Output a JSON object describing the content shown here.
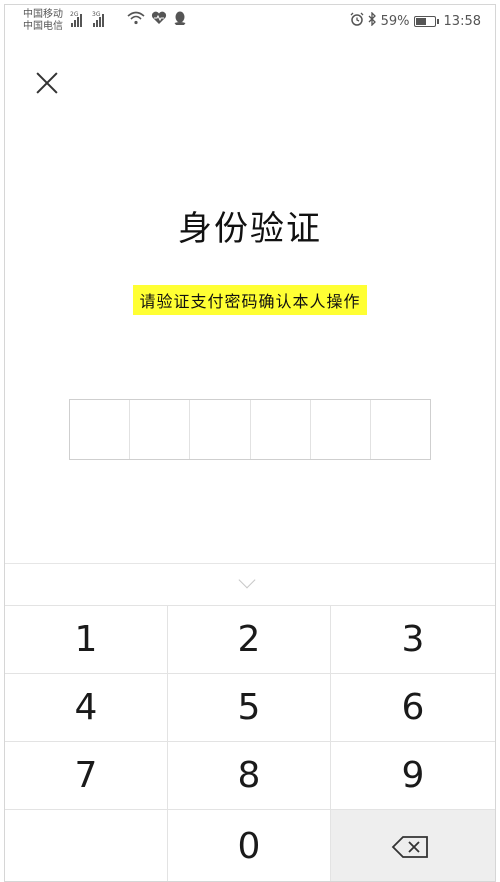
{
  "status_bar": {
    "carrier_1": "中国移动",
    "carrier_2": "中国电信",
    "network_1": "2G",
    "network_2": "3G",
    "battery_percent": "59%",
    "battery_level": 0.59,
    "time": "13:58",
    "icons": [
      "signal-icon",
      "signal-icon",
      "wifi-icon",
      "heart-rate-icon",
      "qq-icon",
      "alarm-icon",
      "bluetooth-icon",
      "battery-icon"
    ]
  },
  "header": {
    "close_icon": "close-icon",
    "title": "身份验证",
    "subtitle": "请验证支付密码确认本人操作",
    "highlight_color": "#ffff33"
  },
  "pin": {
    "length": 6,
    "entered": 0
  },
  "keyboard": {
    "collapse_icon": "chevron-down-icon",
    "keys": [
      "1",
      "2",
      "3",
      "4",
      "5",
      "6",
      "7",
      "8",
      "9",
      "",
      "0",
      "delete"
    ]
  }
}
